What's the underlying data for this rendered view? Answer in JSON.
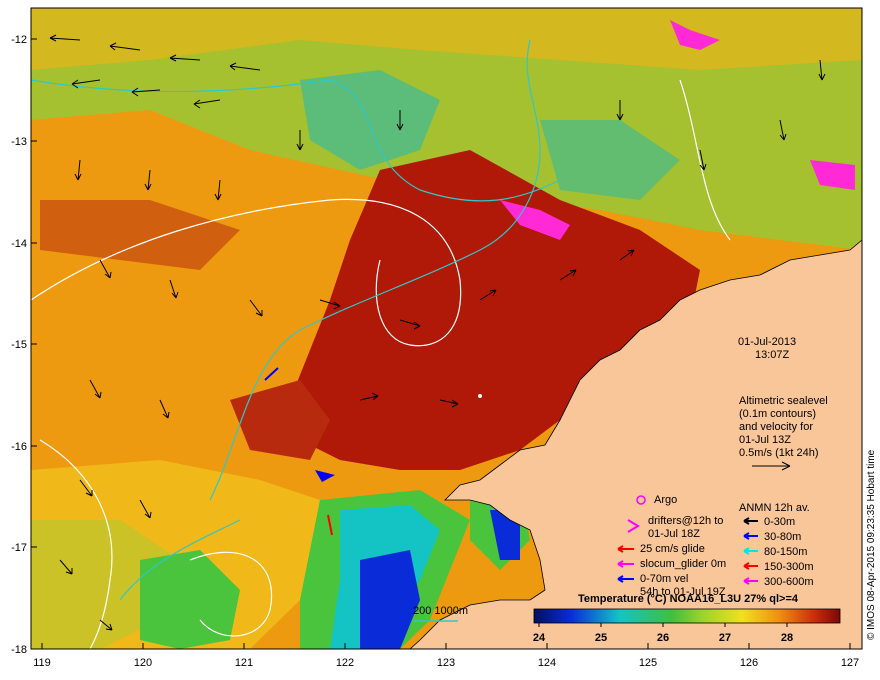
{
  "map": {
    "axis": {
      "x_ticks": [
        "119",
        "120",
        "121",
        "122",
        "123",
        "124",
        "125",
        "126",
        "127"
      ],
      "y_ticks": [
        "-12",
        "-13",
        "-14",
        "-15",
        "-16",
        "-17",
        "-18"
      ]
    },
    "date_label": "01-Jul-2013",
    "time_label": "13:07Z",
    "altimetry_text": [
      "Altimetric sealevel",
      "(0.1m contours)",
      "and velocity for",
      "01-Jul 13Z",
      "0.5m/s (1kt 24h)"
    ],
    "legend_left": {
      "argo": "Argo",
      "drifters": [
        "drifters@12h to",
        "01-Jul 18Z"
      ],
      "glide": "25 cm/s glide",
      "slocum": "slocum_glider 0m",
      "vel": [
        "0-70m vel",
        "54h to 01-Jul 19Z"
      ]
    },
    "legend_anmn": {
      "title": "ANMN 12h av.",
      "items": [
        "0-30m",
        "30-80m",
        "80-150m",
        "150-300m",
        "300-600m"
      ],
      "colors": [
        "#000000",
        "#0000ff",
        "#00e5e5",
        "#ff0000",
        "#ff00ff"
      ]
    },
    "colorbar": {
      "title": "Temperature (°C) NOAA16_L3U 27% ql>=4",
      "ticks": [
        "24",
        "25",
        "26",
        "27",
        "28"
      ]
    },
    "isobath_label": "200  1000m",
    "credit": "© IMOS 08-Apr-2015 09:23:35 Hobart time",
    "colors": {
      "land": "#f9c69a",
      "warm": "#b01808",
      "orange": "#ee9a10",
      "green": "#49c43c",
      "cyan": "#14c4c4",
      "blue": "#0a2bd8",
      "magenta": "#ff2ad6"
    }
  }
}
